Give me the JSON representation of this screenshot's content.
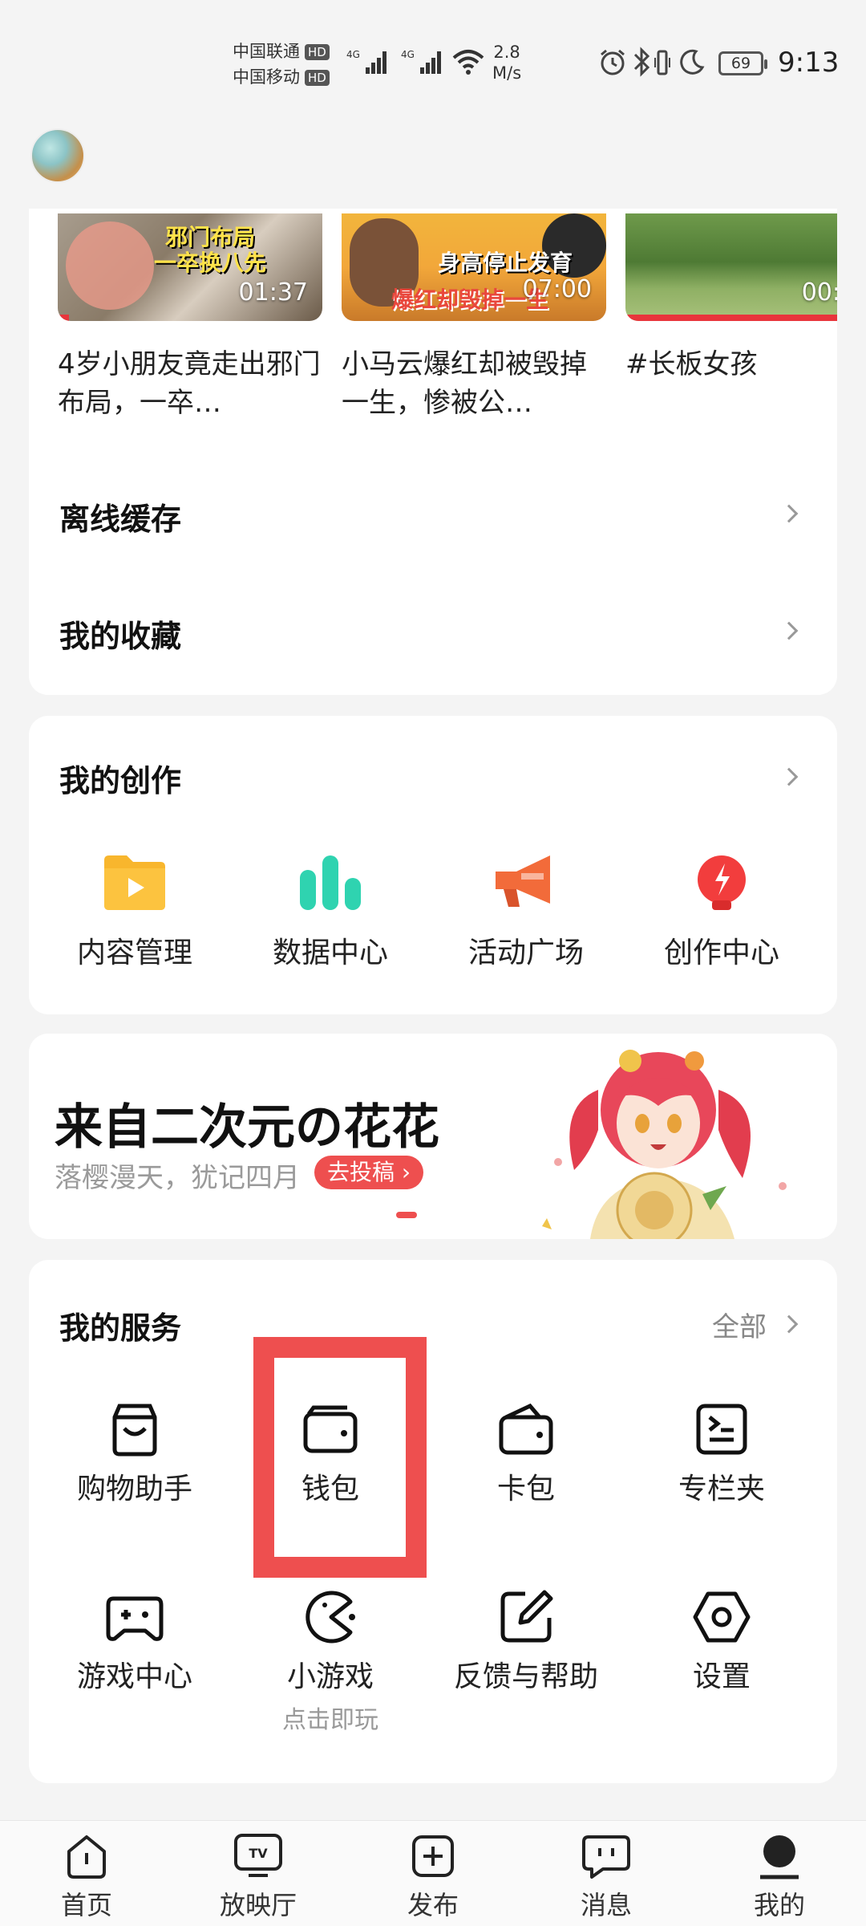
{
  "status_bar": {
    "carrier1": "中国联通",
    "carrier2": "中国移动",
    "hd": "HD",
    "net": "4G",
    "speed_value": "2.8",
    "speed_unit": "M/s",
    "battery": "69",
    "time": "9:13"
  },
  "videos": [
    {
      "title": "4岁小朋友竟走出邪门布局，一卒…",
      "duration": "01:37",
      "caption1": "邪门布局",
      "caption2": "一卒换八先"
    },
    {
      "title": "小马云爆红却被毁掉一生，惨被公…",
      "duration": "07:00",
      "caption1": "身高停止发育",
      "caption2": "爆红却毁掉一生"
    },
    {
      "title": "#长板女孩",
      "duration": "00:"
    }
  ],
  "list_items": {
    "offline": "离线缓存",
    "favorites": "我的收藏"
  },
  "creation": {
    "title": "我的创作",
    "tools": [
      "内容管理",
      "数据中心",
      "活动广场",
      "创作中心"
    ]
  },
  "banner": {
    "title": "来自二次元の花花",
    "subtitle": "落樱漫天，犹记四月",
    "cta": "去投稿"
  },
  "services": {
    "title": "我的服务",
    "all": "全部",
    "items": [
      "购物助手",
      "钱包",
      "卡包",
      "专栏夹",
      "游戏中心",
      "小游戏",
      "反馈与帮助",
      "设置"
    ],
    "mini_game_sub": "点击即玩"
  },
  "nav": {
    "items": [
      "首页",
      "放映厅",
      "发布",
      "消息",
      "我的"
    ],
    "active": "我的"
  },
  "colors": {
    "accent": "#ee4f4f",
    "folder": "#f8b62d",
    "chart": "#2fd3b0",
    "megaphone": "#f26b3a",
    "bulb": "#f23d3d"
  }
}
